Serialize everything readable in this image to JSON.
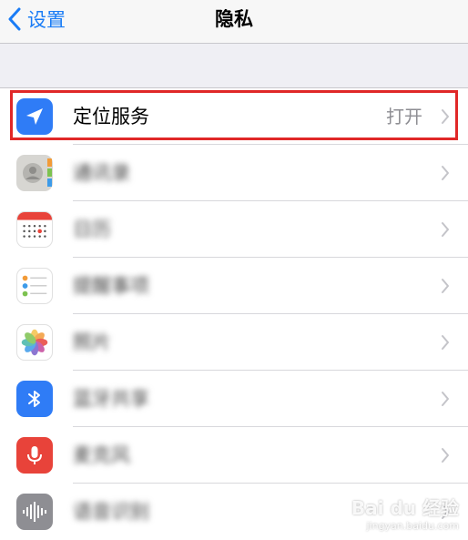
{
  "nav": {
    "back_label": "设置",
    "title": "隐私"
  },
  "rows": [
    {
      "label": "定位服务",
      "value": "打开",
      "icon": "location-arrow-icon",
      "color": "#2f7cf6"
    },
    {
      "label": "通讯录",
      "icon": "contacts-icon",
      "color": "#d7d6d2"
    },
    {
      "label": "日历",
      "icon": "calendar-icon",
      "color": "#ffffff"
    },
    {
      "label": "提醒事项",
      "icon": "reminders-icon",
      "color": "#ffffff"
    },
    {
      "label": "照片",
      "icon": "photos-icon",
      "color": "#ffffff"
    },
    {
      "label": "蓝牙共享",
      "icon": "bluetooth-icon",
      "color": "#2f7cf6"
    },
    {
      "label": "麦克风",
      "icon": "microphone-icon",
      "color": "#e8433a"
    },
    {
      "label": "语音识别",
      "icon": "speech-recognition-icon",
      "color": "#8e8e93"
    }
  ],
  "watermark": {
    "main": "Bai du 经验",
    "sub": "jingyan.baidu.com"
  }
}
